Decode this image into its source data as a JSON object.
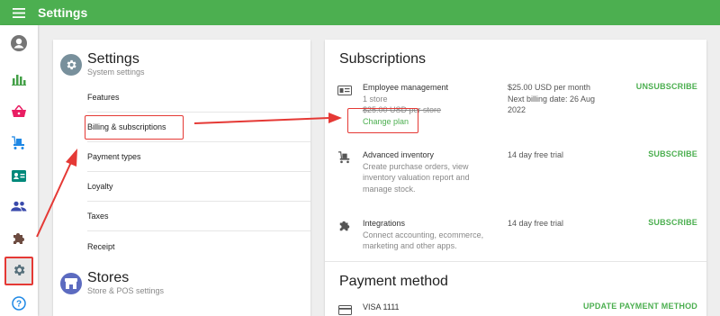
{
  "app": {
    "title": "Settings"
  },
  "rail_icons": [
    "account-icon",
    "reports-icon",
    "basket-icon",
    "items-icon",
    "customers-card-icon",
    "employees-icon",
    "integrations-icon",
    "settings-icon",
    "help-icon"
  ],
  "settings_section": {
    "title": "Settings",
    "subtitle": "System settings"
  },
  "nav": [
    "Features",
    "Billing & subscriptions",
    "Payment types",
    "Loyalty",
    "Taxes",
    "Receipt"
  ],
  "stores_section": {
    "title": "Stores",
    "subtitle": "Store & POS settings"
  },
  "subscriptions": {
    "title": "Subscriptions",
    "items": [
      {
        "name": "Employee management",
        "line2": "1 store",
        "old_price": "$25.00 USD per store",
        "link": "Change plan",
        "price": "$25.00 USD per month",
        "billing": "Next billing date: 26 Aug 2022",
        "action": "UNSUBSCRIBE"
      },
      {
        "name": "Advanced inventory",
        "desc": "Create purchase orders, view inventory valuation report and manage stock.",
        "price": "14 day free trial",
        "action": "SUBSCRIBE"
      },
      {
        "name": "Integrations",
        "desc": "Connect accounting, ecommerce, marketing and other apps.",
        "price": "14 day free trial",
        "action": "SUBSCRIBE"
      }
    ]
  },
  "payment": {
    "title": "Payment method",
    "card": "VISA 1111",
    "action": "UPDATE PAYMENT METHOD"
  },
  "colors": {
    "primary": "#4caf50",
    "annotation": "#e53935"
  }
}
